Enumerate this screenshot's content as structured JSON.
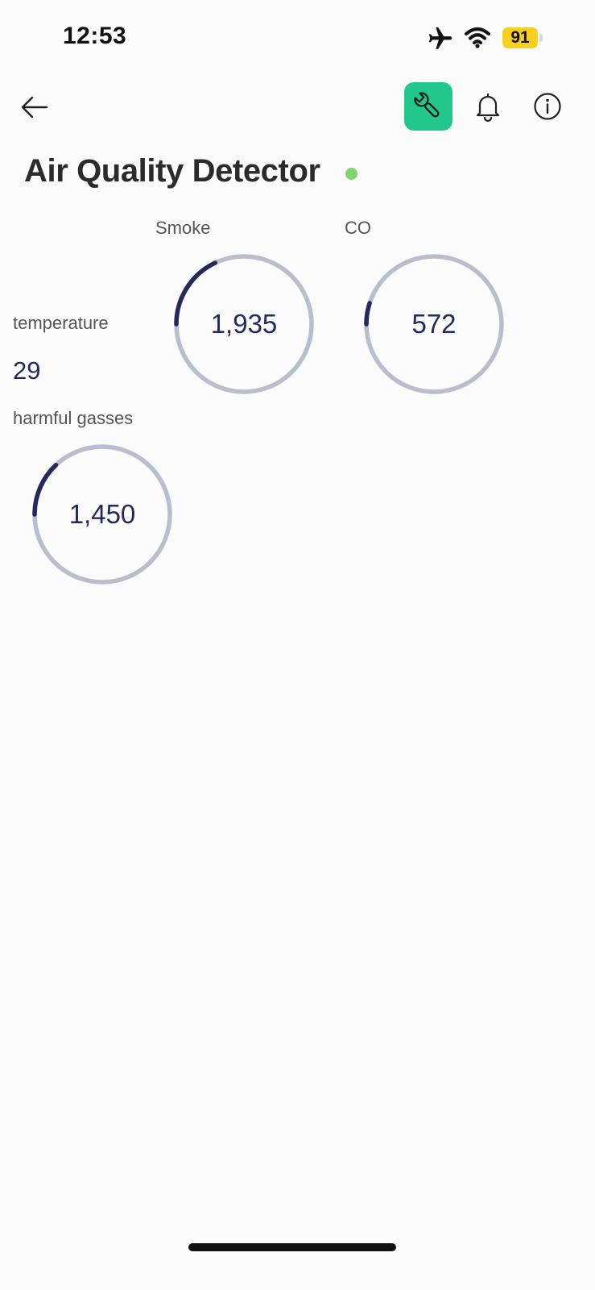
{
  "status_bar": {
    "time": "12:53",
    "battery": "91",
    "icons": [
      "airplane-icon",
      "wifi-icon",
      "battery-icon"
    ]
  },
  "header": {
    "back_icon": "arrow-left-icon",
    "settings_icon": "wrench-icon",
    "notifications_icon": "bell-icon",
    "info_icon": "info-icon"
  },
  "page": {
    "title": "Air Quality Detector",
    "online_status_color": "#7dd669"
  },
  "colors": {
    "accent": "#21c78c",
    "gauge_track": "#babdcb",
    "gauge_progress": "#23295a"
  },
  "sensors": {
    "smoke": {
      "label": "Smoke",
      "value": "1,935",
      "fill": 0.18
    },
    "co": {
      "label": "CO",
      "value": "572",
      "fill": 0.05
    },
    "temperature": {
      "label": "temperature",
      "value": "29"
    },
    "harmful_gasses": {
      "label": "harmful gasses",
      "value": "1,450",
      "fill": 0.13
    }
  }
}
